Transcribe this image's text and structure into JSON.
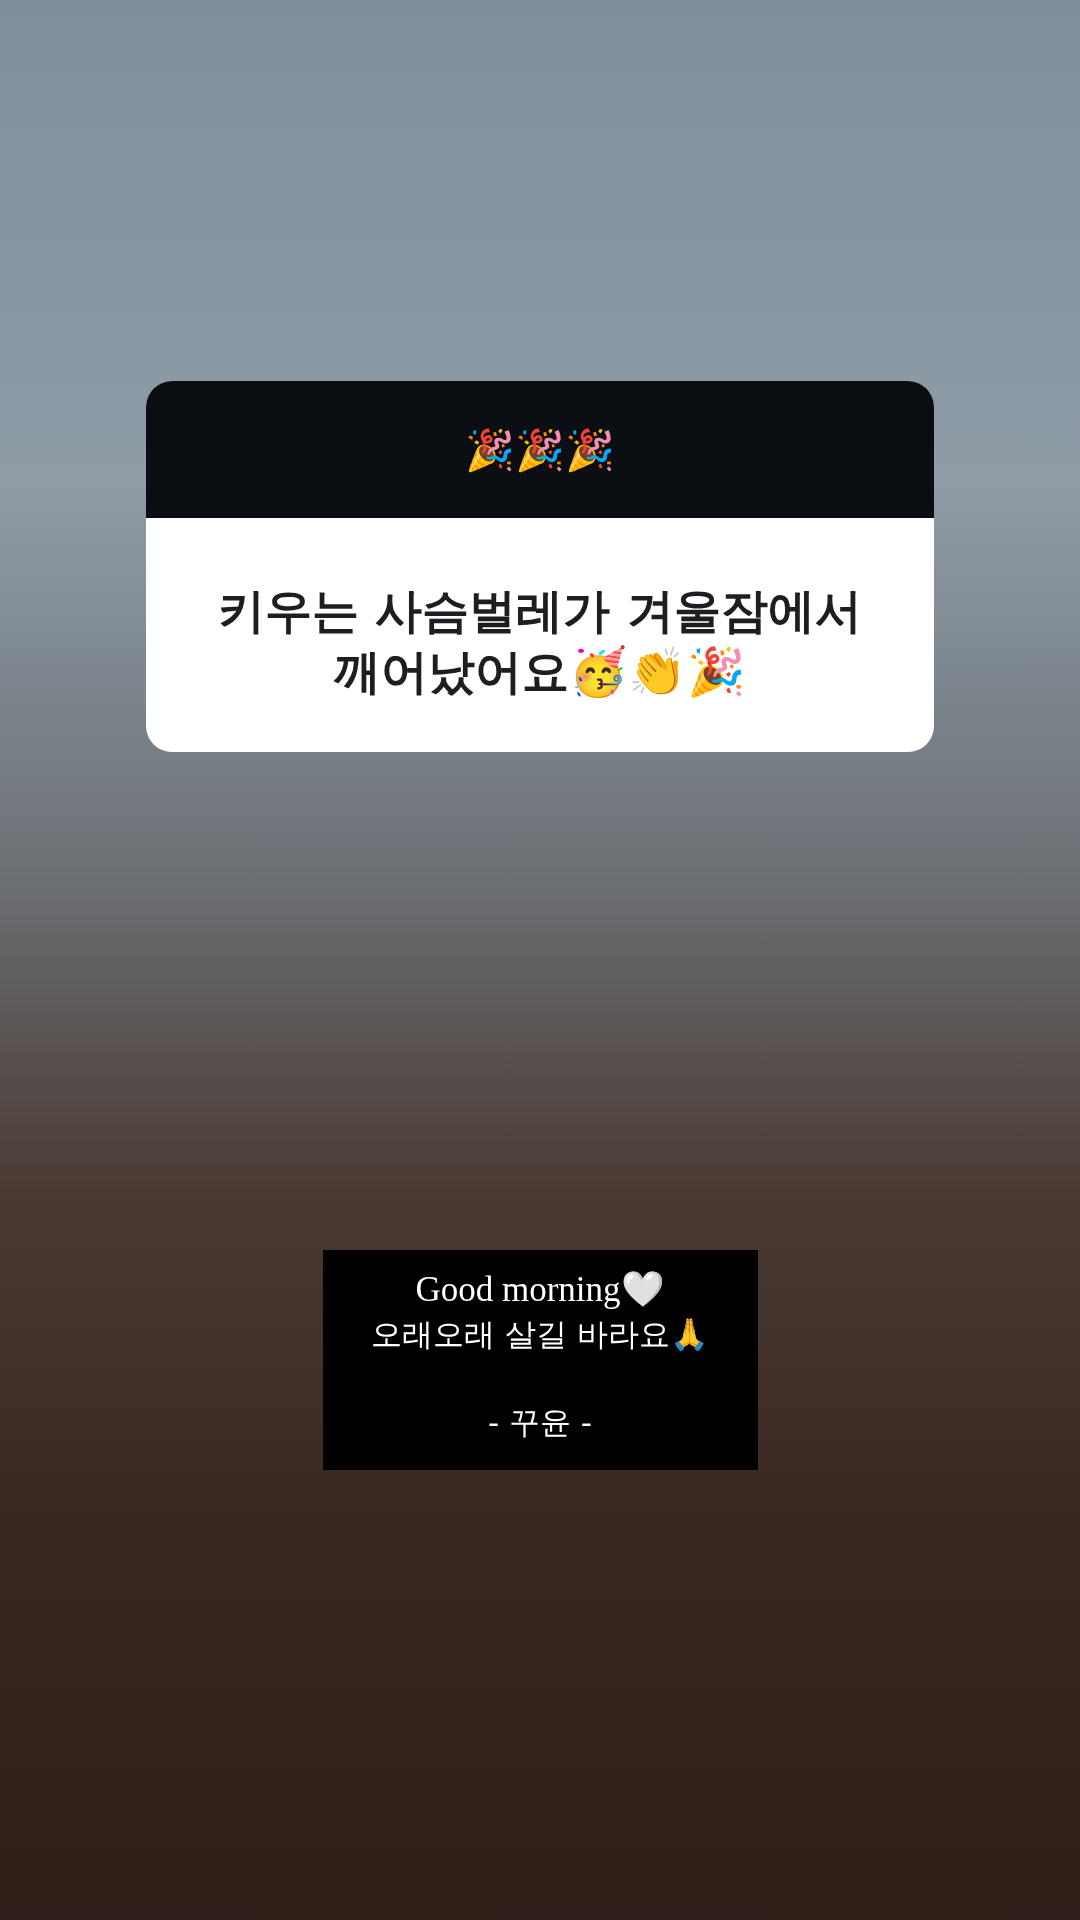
{
  "question_sticker": {
    "header": "🎉🎉🎉",
    "text": "키우는 사슴벌레가 겨울잠에서 깨어났어요🥳👏🎉"
  },
  "caption": {
    "lines": [
      {
        "text": "Good morning🤍",
        "kind": "serif"
      },
      {
        "text": "오래오래 살길 바라요🙏",
        "kind": "sans"
      }
    ],
    "signature": "- 꾸윤 -"
  }
}
